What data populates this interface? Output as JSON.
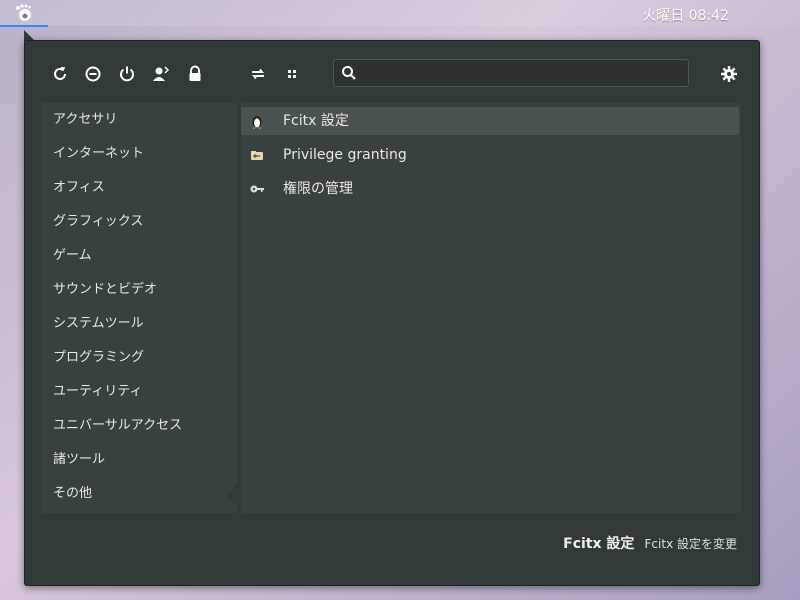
{
  "topbar": {
    "clock": "火曜日 08:42"
  },
  "search": {
    "placeholder": "",
    "value": ""
  },
  "categories": [
    "アクセサリ",
    "インターネット",
    "オフィス",
    "グラフィックス",
    "ゲーム",
    "サウンドとビデオ",
    "システムツール",
    "プログラミング",
    "ユーティリティ",
    "ユニバーサルアクセス",
    "諸ツール",
    "その他"
  ],
  "apps": [
    {
      "label": "Fcitx 設定",
      "icon": "fcitx-penguin-icon",
      "selected": true
    },
    {
      "label": "Privilege granting",
      "icon": "privilege-folder-icon",
      "selected": false
    },
    {
      "label": "権限の管理",
      "icon": "key-icon",
      "selected": false
    }
  ],
  "status": {
    "name": "Fcitx 設定",
    "description": "Fcitx 設定を変更"
  },
  "colors": {
    "menu_bg": "#323939",
    "panel_bg": "#394040",
    "selected_bg": "#4a5252",
    "accent": "#3a84ff"
  },
  "toolbar_icons": [
    "reload-icon",
    "logout-minus-icon",
    "power-icon",
    "switch-user-icon",
    "lock-icon",
    "transfer-icon",
    "grid-view-icon",
    "settings-gear-icon"
  ]
}
